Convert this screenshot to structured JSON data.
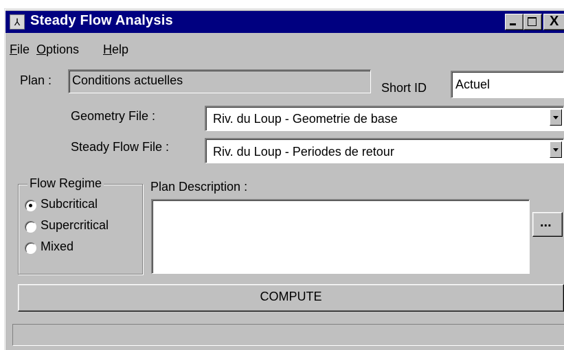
{
  "window": {
    "title": "Steady Flow Analysis",
    "title_bar_color": "#000080",
    "face_color": "#c0c0c0",
    "app_icon": "hec-ras-icon",
    "app_icon_glyph": "⅄",
    "controls": {
      "minimize_icon": "minimize-icon",
      "maximize_icon": "maximize-icon",
      "close_icon": "close-icon",
      "close_glyph": "X"
    }
  },
  "menu": {
    "items": [
      {
        "mnemonic": "F",
        "rest": "ile"
      },
      {
        "mnemonic": "O",
        "rest": "ptions"
      },
      {
        "mnemonic": "H",
        "rest": "elp"
      }
    ]
  },
  "plan": {
    "label": "Plan :",
    "value": "Conditions actuelles",
    "short_id_label": "Short ID",
    "short_id_value": "Actuel"
  },
  "geometry": {
    "label": "Geometry File :",
    "selected": "Riv. du Loup - Geometrie de base"
  },
  "steady_flow": {
    "label": "Steady Flow File :",
    "selected": "Riv. du Loup - Periodes de retour"
  },
  "flow_regime": {
    "title": "Flow Regime",
    "options": [
      "Subcritical",
      "Supercritical",
      "Mixed"
    ],
    "selected": "Subcritical"
  },
  "description": {
    "label": "Plan Description :",
    "value": "",
    "ellipsis_label": "..."
  },
  "compute": {
    "label": "COMPUTE"
  },
  "status": {
    "text": ""
  }
}
